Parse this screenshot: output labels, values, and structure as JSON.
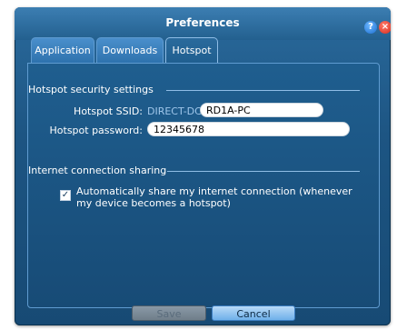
{
  "window": {
    "title": "Preferences"
  },
  "tabs": [
    {
      "label": "Application",
      "active": false
    },
    {
      "label": "Downloads",
      "active": false
    },
    {
      "label": "Hotspot",
      "active": true
    }
  ],
  "hotspot_security": {
    "heading": "Hotspot security settings",
    "ssid_label": "Hotspot SSID:",
    "ssid_prefix": "DIRECT-DC-",
    "ssid_value": "RD1A-PC",
    "password_label": "Hotspot password:",
    "password_value": "12345678"
  },
  "internet_sharing": {
    "heading": "Internet connection sharing",
    "auto_share_label": "Automatically share my internet connection (whenever my device becomes a hotspot)",
    "auto_share_checked": true
  },
  "buttons": {
    "save_label": "Save",
    "cancel_label": "Cancel"
  },
  "icons": {
    "help": "help-icon",
    "close": "close-icon"
  },
  "colors": {
    "window_bg": "#1d5583",
    "title_bar": "#2e6fa3",
    "accent": "#6fb0ea",
    "close": "#d42a1b",
    "help": "#1e6fd0"
  }
}
